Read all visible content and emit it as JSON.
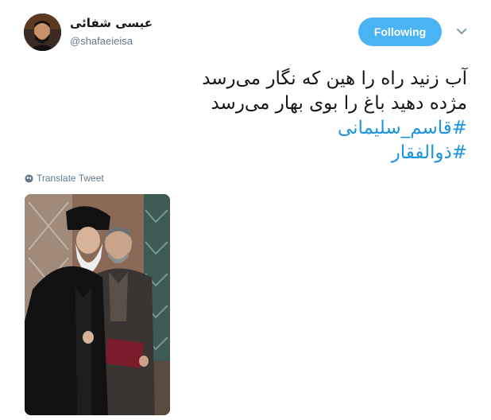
{
  "user": {
    "display_name": "عیسی شفائی",
    "handle": "@shafaeieisa"
  },
  "follow_button": {
    "label": "Following"
  },
  "tweet": {
    "lines": [
      "آب زنید راه را هین که نگار می‌رسد",
      "مژده دهید باغ را بوی بهار می‌رسد"
    ],
    "hashtags": [
      "#قاسم_سلیمانی",
      "#ذوالفقار"
    ]
  },
  "translate": {
    "label": "Translate Tweet"
  },
  "icons": {
    "more": "chevron-down-icon",
    "translate": "globe-icon"
  },
  "colors": {
    "follow_bg": "#4ab3f4",
    "hashtag": "#1b95e0",
    "muted": "#657786"
  }
}
